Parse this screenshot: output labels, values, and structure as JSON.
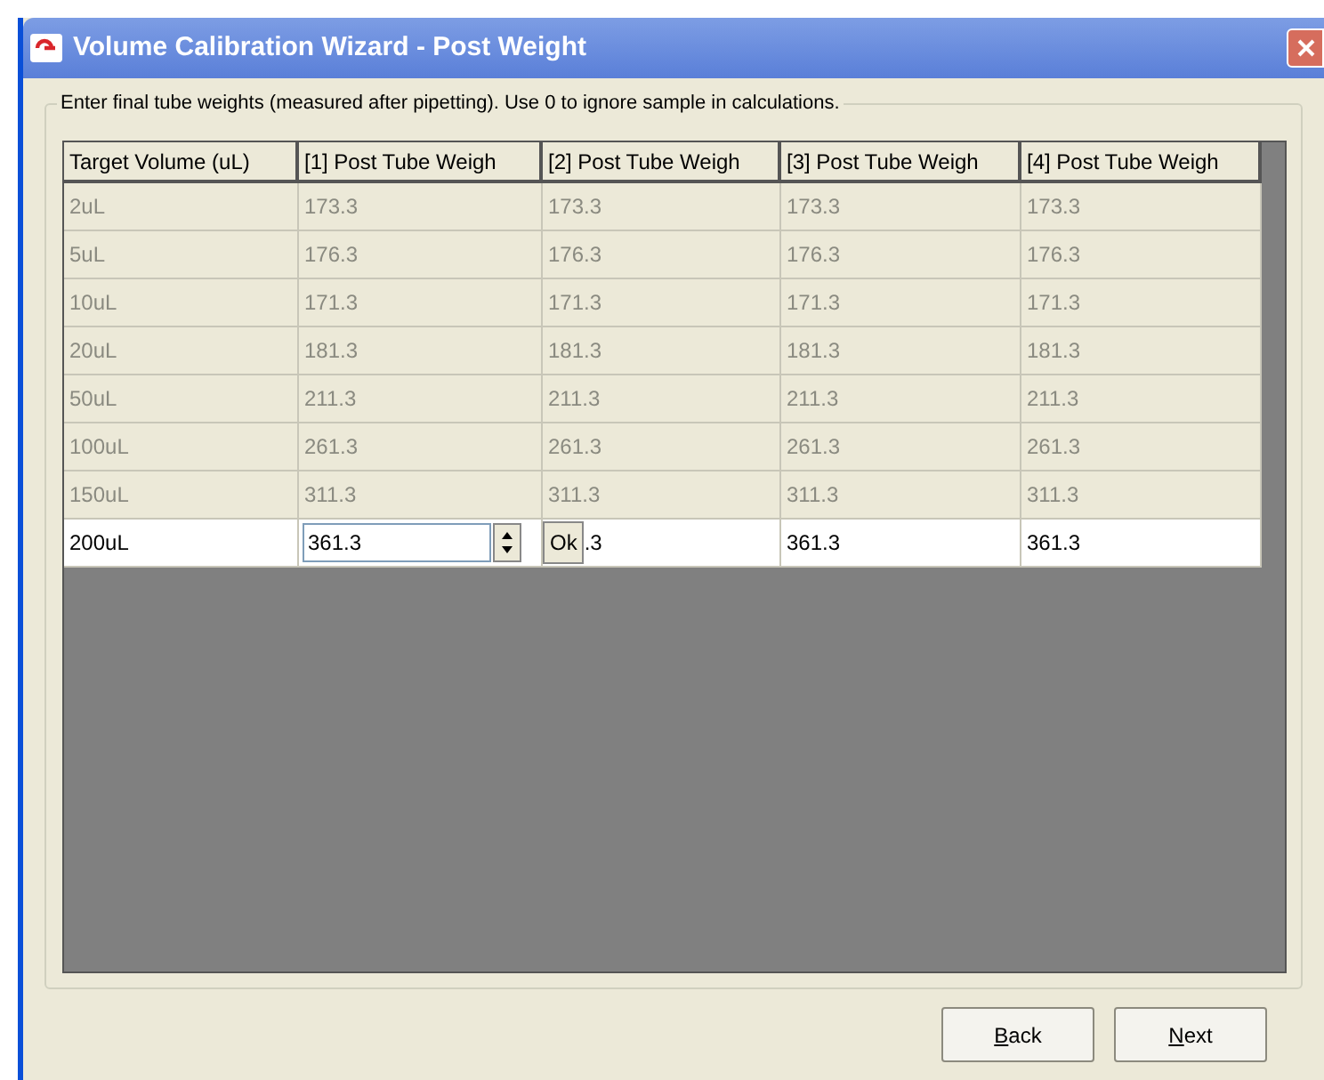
{
  "window": {
    "title": "Volume Calibration Wizard - Post Weight"
  },
  "group": {
    "caption": "Enter final tube weights (measured after pipetting). Use 0 to ignore sample in calculations."
  },
  "table": {
    "columns": [
      "Target Volume (uL)",
      "[1] Post Tube Weigh",
      "[2] Post Tube Weigh",
      "[3] Post Tube Weigh",
      "[4] Post Tube Weigh"
    ],
    "rows": [
      {
        "selected": false,
        "cells": [
          {
            "kind": "text",
            "value": "2uL"
          },
          {
            "kind": "text",
            "value": "173.3"
          },
          {
            "kind": "text",
            "value": "173.3"
          },
          {
            "kind": "text",
            "value": "173.3"
          },
          {
            "kind": "text",
            "value": "173.3"
          }
        ]
      },
      {
        "selected": false,
        "cells": [
          {
            "kind": "text",
            "value": "5uL"
          },
          {
            "kind": "text",
            "value": "176.3"
          },
          {
            "kind": "text",
            "value": "176.3"
          },
          {
            "kind": "text",
            "value": "176.3"
          },
          {
            "kind": "text",
            "value": "176.3"
          }
        ]
      },
      {
        "selected": false,
        "cells": [
          {
            "kind": "text",
            "value": "10uL"
          },
          {
            "kind": "text",
            "value": "171.3"
          },
          {
            "kind": "text",
            "value": "171.3"
          },
          {
            "kind": "text",
            "value": "171.3"
          },
          {
            "kind": "text",
            "value": "171.3"
          }
        ]
      },
      {
        "selected": false,
        "cells": [
          {
            "kind": "text",
            "value": "20uL"
          },
          {
            "kind": "text",
            "value": "181.3"
          },
          {
            "kind": "text",
            "value": "181.3"
          },
          {
            "kind": "text",
            "value": "181.3"
          },
          {
            "kind": "text",
            "value": "181.3"
          }
        ]
      },
      {
        "selected": false,
        "cells": [
          {
            "kind": "text",
            "value": "50uL"
          },
          {
            "kind": "text",
            "value": "211.3"
          },
          {
            "kind": "text",
            "value": "211.3"
          },
          {
            "kind": "text",
            "value": "211.3"
          },
          {
            "kind": "text",
            "value": "211.3"
          }
        ]
      },
      {
        "selected": false,
        "cells": [
          {
            "kind": "text",
            "value": "100uL"
          },
          {
            "kind": "text",
            "value": "261.3"
          },
          {
            "kind": "text",
            "value": "261.3"
          },
          {
            "kind": "text",
            "value": "261.3"
          },
          {
            "kind": "text",
            "value": "261.3"
          }
        ]
      },
      {
        "selected": false,
        "cells": [
          {
            "kind": "text",
            "value": "150uL"
          },
          {
            "kind": "text",
            "value": "311.3"
          },
          {
            "kind": "text",
            "value": "311.3"
          },
          {
            "kind": "text",
            "value": "311.3"
          },
          {
            "kind": "text",
            "value": "311.3"
          }
        ]
      },
      {
        "selected": true,
        "cells": [
          {
            "kind": "text",
            "value": "200uL"
          },
          {
            "kind": "editor",
            "value": "361.3"
          },
          {
            "kind": "covered",
            "button": "Ok",
            "value": ".3"
          },
          {
            "kind": "text",
            "value": "361.3"
          },
          {
            "kind": "text",
            "value": "361.3"
          }
        ]
      }
    ]
  },
  "buttons": [
    {
      "label": "Back",
      "underline_first": true
    },
    {
      "label": "Next",
      "underline_first": true
    }
  ]
}
